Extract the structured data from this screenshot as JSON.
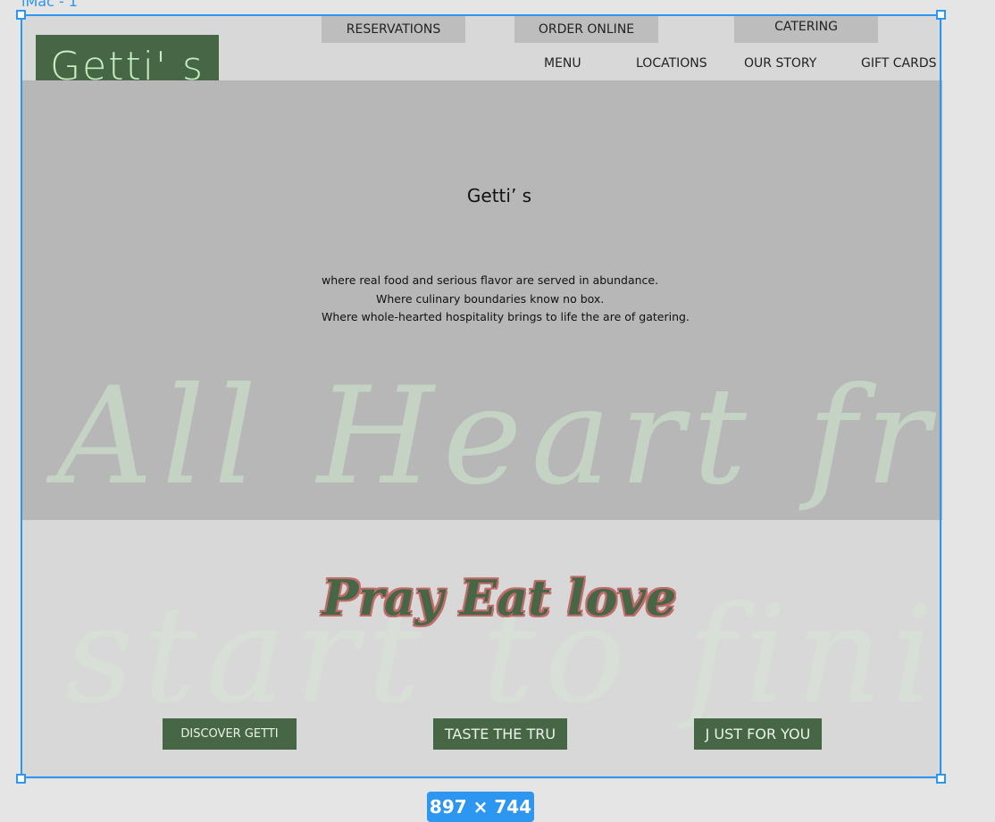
{
  "frame": {
    "label": "iMac - 1",
    "size_badge": "897 × 744"
  },
  "brand": {
    "logo": "Getti' s"
  },
  "top_buttons": {
    "reservations": "RESERVATIONS",
    "order_online": "ORDER ONLINE",
    "catering": "CATERING"
  },
  "nav": {
    "menu": "MENU",
    "locations": "LOCATIONS",
    "our_story": "OUR STORY",
    "gift_cards": "GIFT CARDS"
  },
  "hero": {
    "title": "Getti’ s",
    "line1": "where real food and serious flavor are served in abundance.",
    "line2": "Where culinary boundaries know no box.",
    "line3": "Where whole-hearted hospitality brings to life the are of gatering.",
    "script_top": "All Heart from",
    "script_bottom": "start to finish"
  },
  "slogan": "Pray Eat love",
  "cta": {
    "discover": "DISCOVER GETTI",
    "taste": "TASTE THE TRU",
    "just_for_you": "J UST FOR YOU"
  },
  "colors": {
    "selection": "#2d96f0",
    "brand_green": "#476646",
    "logo_text": "#c6eec0",
    "hero_bg": "#b7b7b7",
    "page_bg": "#d8d8d8"
  }
}
